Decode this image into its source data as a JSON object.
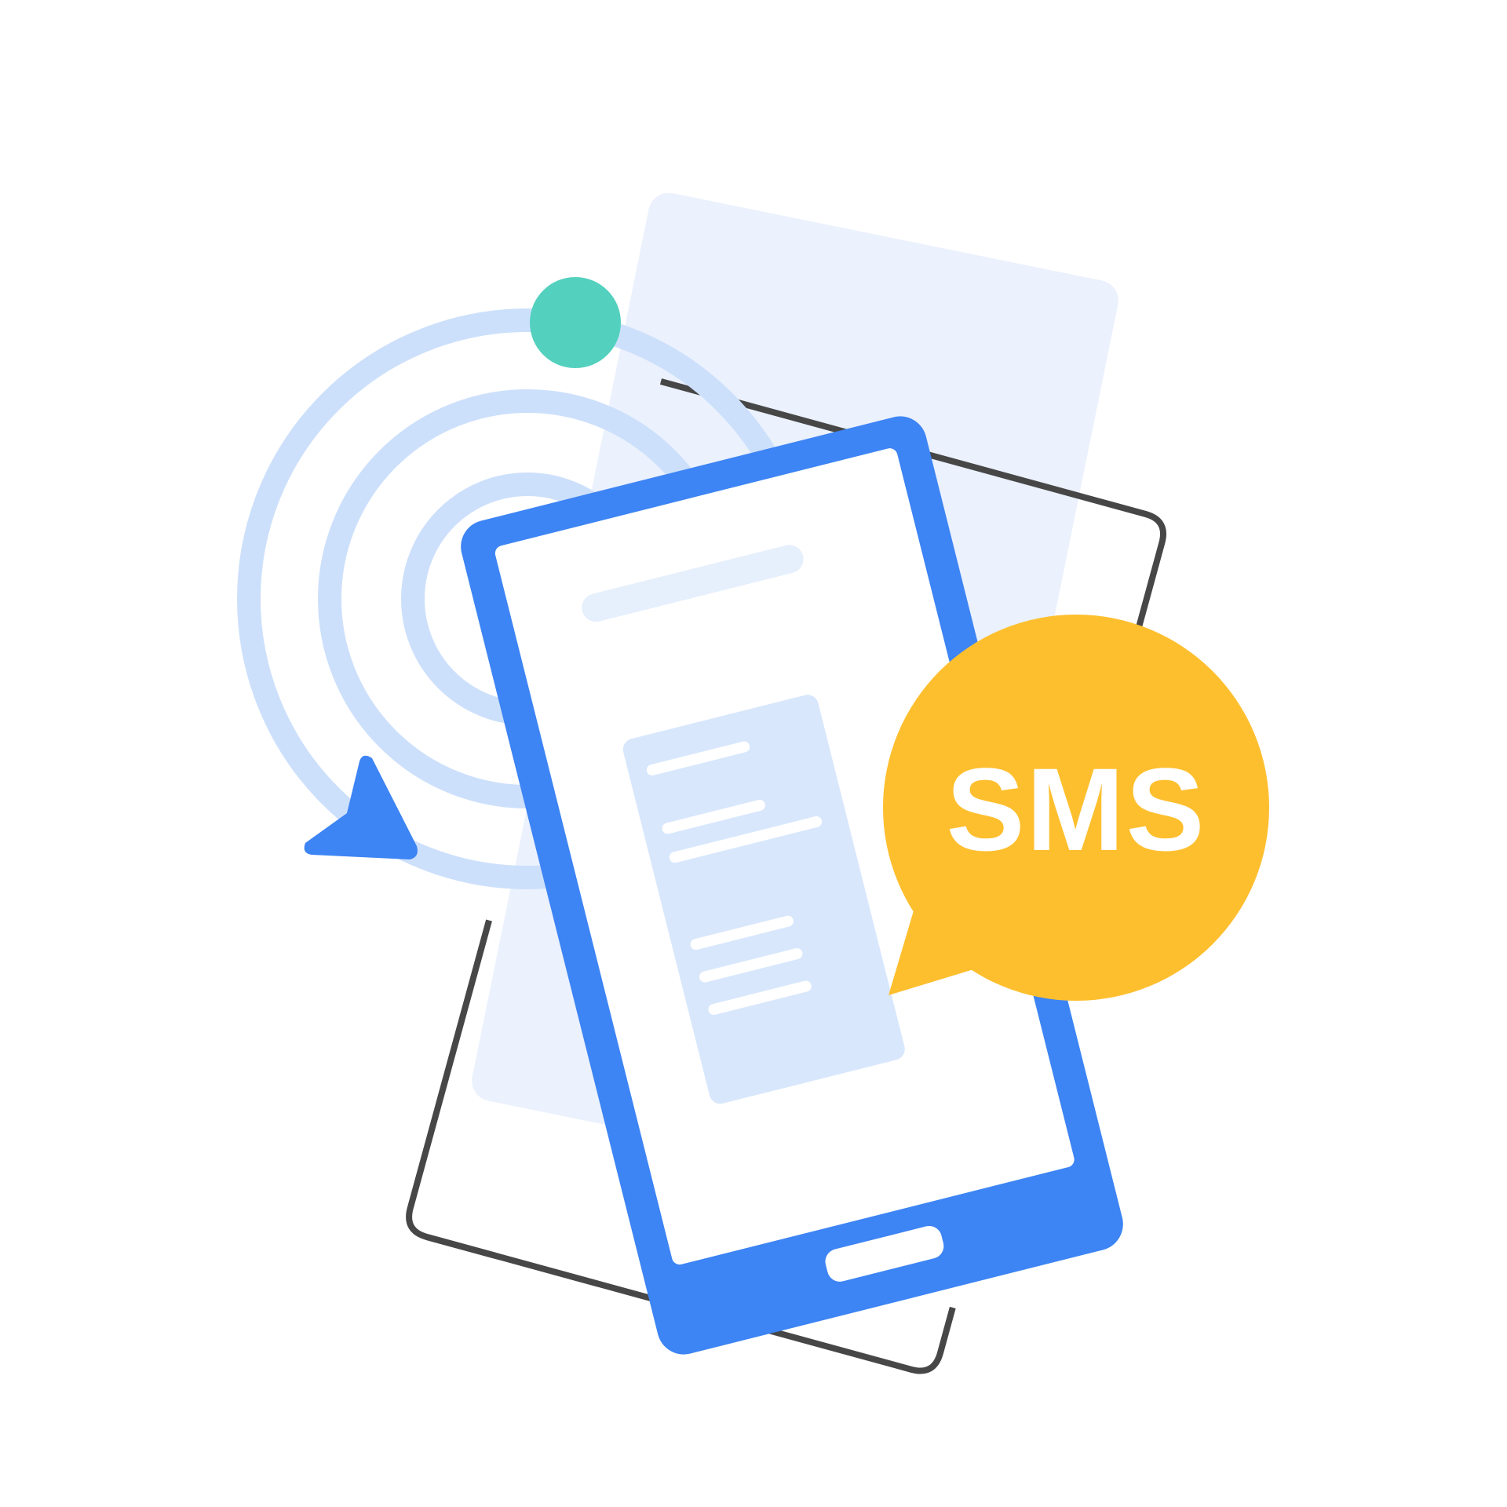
{
  "bubble": {
    "label": "SMS"
  },
  "colors": {
    "background": "#ffffff",
    "back_card": "#EBF1FD",
    "ring": "#CDE0FB",
    "phone_body": "#3D84F4",
    "screen": "#ffffff",
    "content_panel": "#D8E7FC",
    "placeholder_bar": "#E6EFFC",
    "accent_dot": "#53D1BE",
    "bubble": "#FEBF2F",
    "bubble_text": "#ffffff",
    "outline": "#474747",
    "arrow": "#3D84F4"
  },
  "icons": [
    "refresh-arrow-icon",
    "notification-dot-icon",
    "sms-chat-bubble-icon",
    "smartphone-icon"
  ]
}
